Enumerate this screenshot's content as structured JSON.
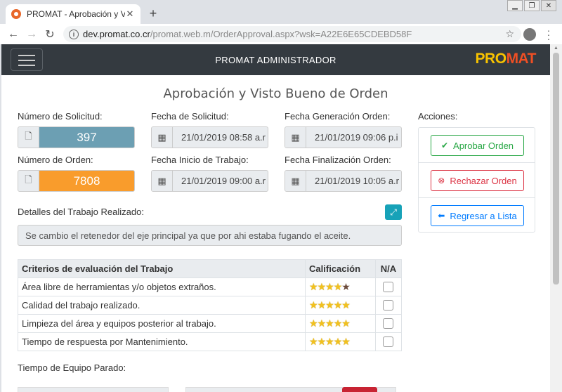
{
  "browser": {
    "tab_title": "PROMAT - Aprobación y Visto B",
    "url_host": "dev.promat.co.cr",
    "url_path": "/promat.web.m/OrderApproval.aspx?wsk=A22E6E65CDEBD58F"
  },
  "navbar": {
    "brand": "PROMAT ADMINISTRADOR",
    "logo_part1": "PRO",
    "logo_part2": "MAT"
  },
  "page_title": "Aprobación y Visto Bueno de Orden",
  "fields": {
    "solicitud_label": "Número de Solicitud:",
    "solicitud_value": "397",
    "fecha_solicitud_label": "Fecha de Solicitud:",
    "fecha_solicitud_value": "21/01/2019 08:58 a.r",
    "fecha_generacion_label": "Fecha Generación Orden:",
    "fecha_generacion_value": "21/01/2019 09:06 p.i",
    "orden_label": "Número de Orden:",
    "orden_value": "7808",
    "fecha_inicio_label": "Fecha Inicio de Trabajo:",
    "fecha_inicio_value": "21/01/2019 09:00 a.r",
    "fecha_final_label": "Fecha Finalización Orden:",
    "fecha_final_value": "21/01/2019 10:05 a.r"
  },
  "details": {
    "label": "Detalles del Trabajo Realizado:",
    "text": "Se cambio el retenedor del eje principal ya que por ahi estaba fugando el aceite."
  },
  "criteria": {
    "headers": {
      "criterio": "Criterios de evaluación del Trabajo",
      "calificacion": "Calificación",
      "na": "N/A"
    },
    "rows": [
      {
        "label": "Área libre de herramientas y/o objetos extraños.",
        "rating": 4,
        "na": false
      },
      {
        "label": "Calidad del trabajo realizado.",
        "rating": 5,
        "na": false
      },
      {
        "label": "Limpieza del área y equipos posterior al trabajo.",
        "rating": 5,
        "na": false
      },
      {
        "label": "Tiempo de respuesta por Mantenimiento.",
        "rating": 5,
        "na": false
      }
    ]
  },
  "downtime_label": "Tiempo de Equipo Parado:",
  "actions": {
    "label": "Acciones:",
    "approve": "Aprobar Orden",
    "reject": "Rechazar Orden",
    "back": "Regresar a Lista"
  },
  "colors": {
    "navbar": "#343a40",
    "solicitud_bg": "#6c9fb3",
    "orden_bg": "#f99c2c",
    "approve": "#28a745",
    "reject": "#dc3545",
    "back": "#007bff"
  }
}
